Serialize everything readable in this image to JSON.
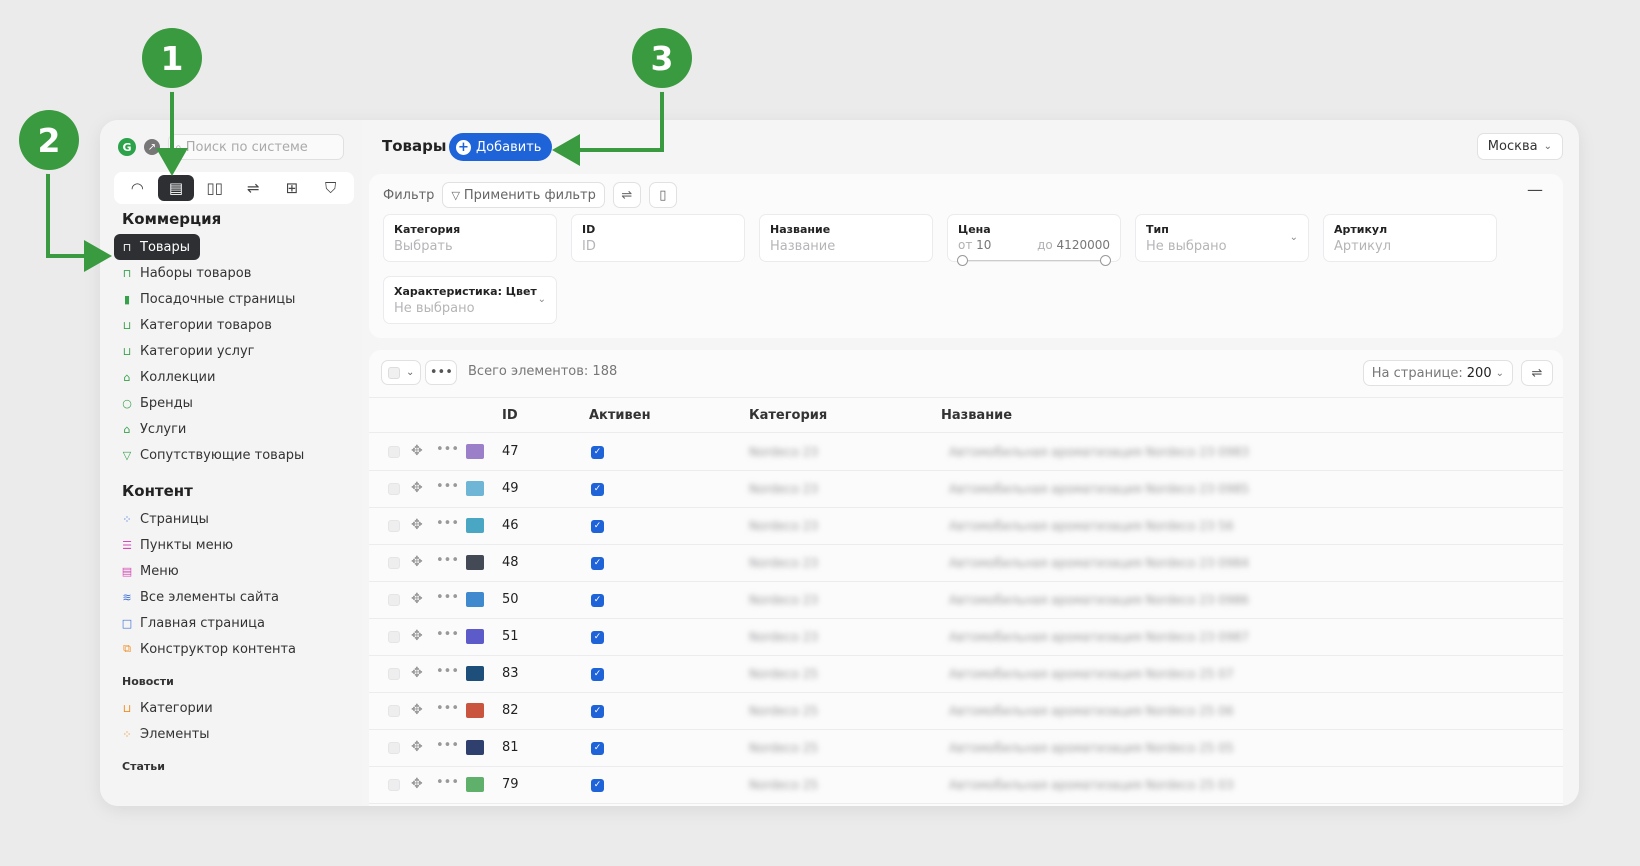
{
  "sidebar": {
    "logo_glyph": "G",
    "search_placeholder": "Поиск по системе",
    "commerce_title": "Коммерция",
    "commerce_items": [
      {
        "label": "Товары",
        "icon": "bag-icon",
        "color": "#ffffff",
        "active": true
      },
      {
        "label": "Наборы товаров",
        "icon": "bag-icon",
        "color": "#37a04a"
      },
      {
        "label": "Посадочные страницы",
        "icon": "page-icon",
        "color": "#37a04a"
      },
      {
        "label": "Категории товаров",
        "icon": "folder-icon",
        "color": "#37a04a"
      },
      {
        "label": "Категории услуг",
        "icon": "folder-icon",
        "color": "#37a04a"
      },
      {
        "label": "Коллекции",
        "icon": "collection-icon",
        "color": "#37a04a"
      },
      {
        "label": "Бренды",
        "icon": "brand-icon",
        "color": "#37a04a"
      },
      {
        "label": "Услуги",
        "icon": "service-icon",
        "color": "#37a04a"
      },
      {
        "label": "Сопутствующие товары",
        "icon": "related-icon",
        "color": "#37a04a"
      }
    ],
    "content_title": "Контент",
    "content_items": [
      {
        "label": "Страницы",
        "icon": "grid-icon",
        "color": "#3b6fd8"
      },
      {
        "label": "Пункты меню",
        "icon": "list-icon",
        "color": "#d54ab5"
      },
      {
        "label": "Меню",
        "icon": "menu-icon",
        "color": "#d54ab5"
      },
      {
        "label": "Все элементы сайта",
        "icon": "layers-icon",
        "color": "#3b6fd8"
      },
      {
        "label": "Главная страница",
        "icon": "square-icon",
        "color": "#3b6fd8"
      },
      {
        "label": "Конструктор контента",
        "icon": "builder-icon",
        "color": "#f08a1c"
      }
    ],
    "news_title": "Новости",
    "news_items": [
      {
        "label": "Категории",
        "icon": "folder-icon",
        "color": "#f08a1c"
      },
      {
        "label": "Элементы",
        "icon": "grid-icon",
        "color": "#f08a1c"
      }
    ],
    "articles_title": "Статьи"
  },
  "header": {
    "title": "Товары",
    "add_label": "Добавить",
    "city": "Москва"
  },
  "filter": {
    "label": "Фильтр",
    "apply_label": "Применить фильтр",
    "fields": {
      "category": {
        "label": "Категория",
        "placeholder": "Выбрать"
      },
      "id": {
        "label": "ID",
        "placeholder": "ID"
      },
      "name": {
        "label": "Название",
        "placeholder": "Название"
      },
      "price": {
        "label": "Цена",
        "from_prefix": "от",
        "from_value": "10",
        "to_prefix": "до",
        "to_value": "4120000"
      },
      "type": {
        "label": "Тип",
        "placeholder": "Не выбрано"
      },
      "article": {
        "label": "Артикул",
        "placeholder": "Артикул"
      },
      "color": {
        "label": "Характеристика: Цвет",
        "placeholder": "Не выбрано"
      }
    }
  },
  "table": {
    "total_label": "Всего элементов: 188",
    "per_page_label": "На странице:",
    "per_page_value": "200",
    "columns": {
      "id": "ID",
      "active": "Активен",
      "category": "Категория",
      "name": "Название"
    },
    "rows": [
      {
        "id": "47",
        "thumb": "#9b7fc9",
        "category": "Nordeco 23",
        "name": "Автомобильная ароматизация Nordeco 23 0983"
      },
      {
        "id": "49",
        "thumb": "#6fb6d6",
        "category": "Nordeco 23",
        "name": "Автомобильная ароматизация Nordeco 23 0985"
      },
      {
        "id": "46",
        "thumb": "#4aa7c4",
        "category": "Nordeco 23",
        "name": "Автомобильная ароматизация Nordeco 23 56"
      },
      {
        "id": "48",
        "thumb": "#444a55",
        "category": "Nordeco 23",
        "name": "Автомобильная ароматизация Nordeco 23 0984"
      },
      {
        "id": "50",
        "thumb": "#3f89cf",
        "category": "Nordeco 23",
        "name": "Автомобильная ароматизация Nordeco 23 0986"
      },
      {
        "id": "51",
        "thumb": "#5d5bc9",
        "category": "Nordeco 23",
        "name": "Автомобильная ароматизация Nordeco 23 0987"
      },
      {
        "id": "83",
        "thumb": "#1d4f7a",
        "category": "Nordeco 25",
        "name": "Автомобильная ароматизация Nordeco 25 07"
      },
      {
        "id": "82",
        "thumb": "#c9553f",
        "category": "Nordeco 25",
        "name": "Автомобильная ароматизация Nordeco 25 06"
      },
      {
        "id": "81",
        "thumb": "#2f3f6e",
        "category": "Nordeco 25",
        "name": "Автомобильная ароматизация Nordeco 25 05"
      },
      {
        "id": "79",
        "thumb": "#5fb06a",
        "category": "Nordeco 25",
        "name": "Автомобильная ароматизация Nordeco 25 03"
      }
    ]
  },
  "annotations": {
    "marker_1": "1",
    "marker_2": "2",
    "marker_3": "3",
    "color": "#3a9a3f"
  }
}
